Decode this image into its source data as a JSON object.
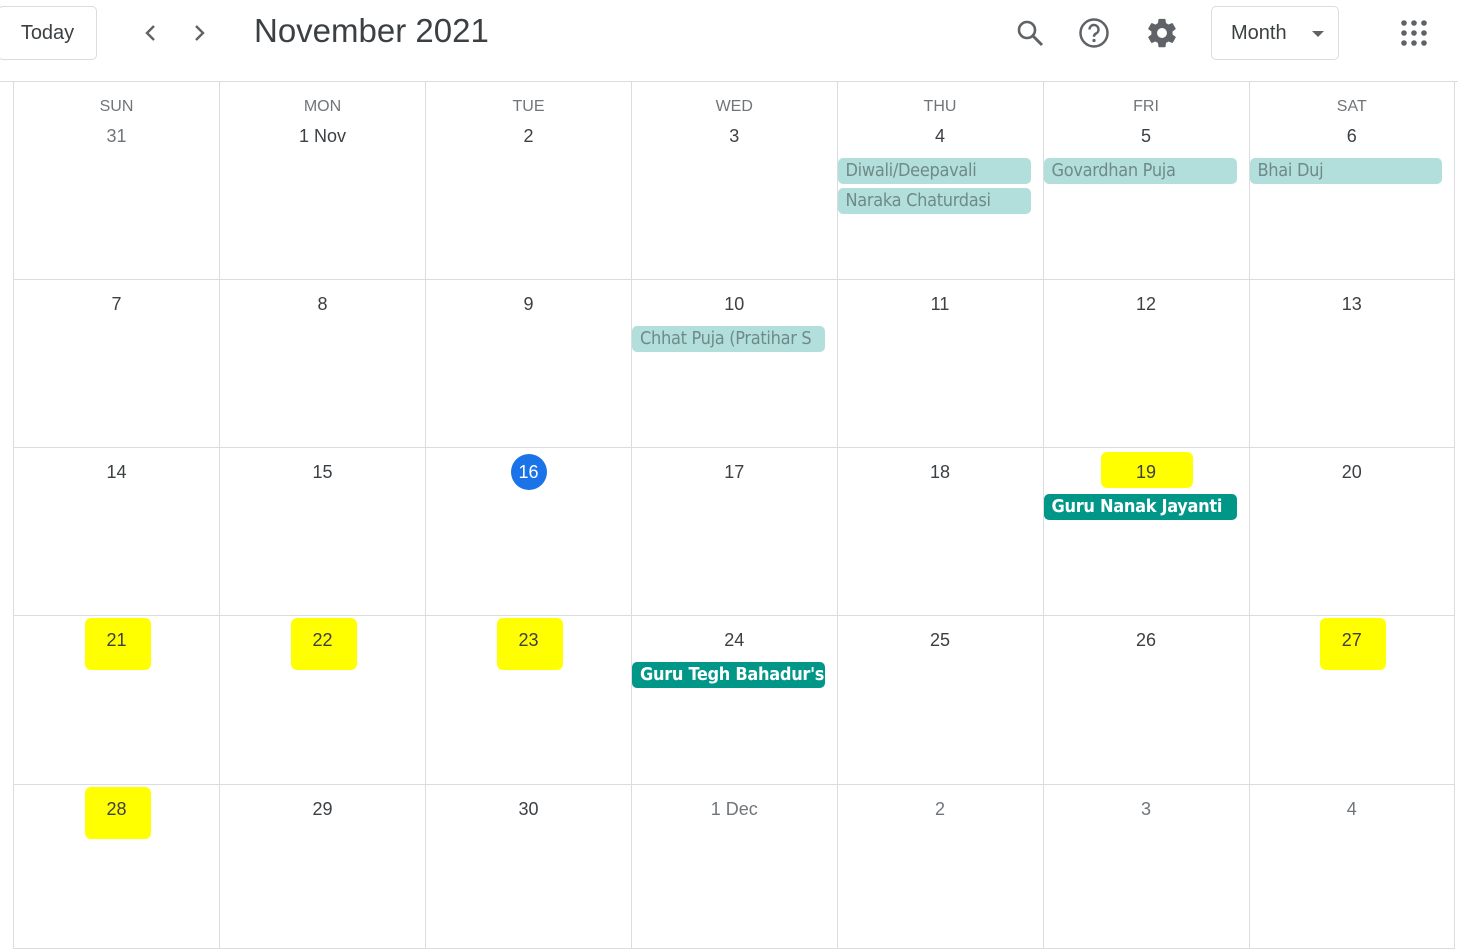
{
  "header": {
    "today_label": "Today",
    "title": "November 2021",
    "view_label": "Month",
    "icons": [
      "chevron-left-icon",
      "chevron-right-icon",
      "search-icon",
      "help-icon",
      "settings-icon",
      "apps-grid-icon"
    ]
  },
  "colors": {
    "accent": "#1a73e8",
    "event_past": "#b2dfdb",
    "event": "#009688",
    "highlight": "#ffff00"
  },
  "weekdays": [
    "SUN",
    "MON",
    "TUE",
    "WED",
    "THU",
    "FRI",
    "SAT"
  ],
  "weeks": [
    [
      {
        "label": "31",
        "other": true
      },
      {
        "label": "1 Nov"
      },
      {
        "label": "2"
      },
      {
        "label": "3"
      },
      {
        "label": "4",
        "events": [
          {
            "title": "Diwali/Deepavali",
            "past": true
          },
          {
            "title": "Naraka Chaturdasi",
            "past": true
          }
        ]
      },
      {
        "label": "5",
        "events": [
          {
            "title": "Govardhan Puja",
            "past": true
          }
        ]
      },
      {
        "label": "6",
        "events": [
          {
            "title": "Bhai Duj",
            "past": true
          }
        ]
      }
    ],
    [
      {
        "label": "7"
      },
      {
        "label": "8"
      },
      {
        "label": "9"
      },
      {
        "label": "10",
        "events": [
          {
            "title": "Chhat Puja (Pratihar S",
            "past": true
          }
        ]
      },
      {
        "label": "11"
      },
      {
        "label": "12"
      },
      {
        "label": "13"
      }
    ],
    [
      {
        "label": "14"
      },
      {
        "label": "15"
      },
      {
        "label": "16",
        "today": true
      },
      {
        "label": "17"
      },
      {
        "label": "18"
      },
      {
        "label": "19",
        "highlighted": true,
        "events": [
          {
            "title": "Guru Nanak Jayanti",
            "past": false
          }
        ]
      },
      {
        "label": "20"
      }
    ],
    [
      {
        "label": "21",
        "highlighted": true
      },
      {
        "label": "22",
        "highlighted": true
      },
      {
        "label": "23",
        "highlighted": true
      },
      {
        "label": "24",
        "events": [
          {
            "title": "Guru Tegh Bahadur's M",
            "past": false
          }
        ]
      },
      {
        "label": "25"
      },
      {
        "label": "26"
      },
      {
        "label": "27",
        "highlighted": true
      }
    ],
    [
      {
        "label": "28",
        "highlighted": true
      },
      {
        "label": "29"
      },
      {
        "label": "30"
      },
      {
        "label": "1 Dec",
        "other": true
      },
      {
        "label": "2",
        "other": true
      },
      {
        "label": "3",
        "other": true
      },
      {
        "label": "4",
        "other": true
      }
    ]
  ]
}
